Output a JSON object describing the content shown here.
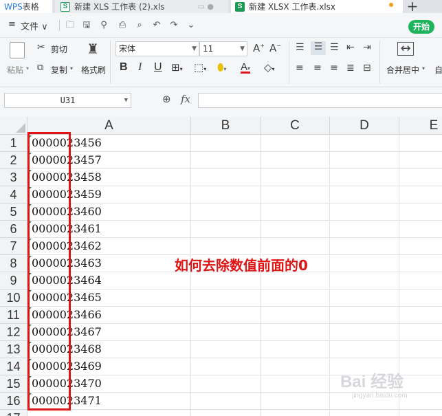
{
  "tabs": {
    "wps_prefix": "WPS",
    "wps_label": " 表格",
    "xls_icon": "S",
    "xls_label": "新建 XLS 工作表 (2).xls",
    "xlsx_icon": "S",
    "xlsx_label": "新建 XLSX 工作表.xlsx",
    "new_tab": "+",
    "unsaved_dot_color": "#f0a020"
  },
  "quickbar": {
    "menu_icon": "≡",
    "file_label": "文件 ∨",
    "icons": [
      "open-folder-icon",
      "save-icon",
      "link-icon",
      "print-icon",
      "print-preview-icon",
      "undo-icon",
      "redo-icon",
      "customize-icon"
    ],
    "start_label": "开始",
    "start_color": "#1eb45e"
  },
  "ribbon": {
    "paste": "粘贴",
    "cut": "剪切",
    "copy": "复制",
    "format_painter": "格式刷",
    "font_name": "宋体",
    "font_size": "11",
    "bold": "B",
    "italic": "I",
    "underline": "U",
    "merge_center": "合并居中",
    "auto_wrap": "自"
  },
  "formula_bar": {
    "cell_ref": "U31",
    "fx": "fx"
  },
  "columns": [
    "A",
    "B",
    "C",
    "D",
    "E"
  ],
  "rows": [
    {
      "num": "1",
      "a": "0000023456"
    },
    {
      "num": "2",
      "a": "0000023457"
    },
    {
      "num": "3",
      "a": "0000023458"
    },
    {
      "num": "4",
      "a": "0000023459"
    },
    {
      "num": "5",
      "a": "0000023460"
    },
    {
      "num": "6",
      "a": "0000023461"
    },
    {
      "num": "7",
      "a": "0000023462"
    },
    {
      "num": "8",
      "a": "0000023463"
    },
    {
      "num": "9",
      "a": "0000023464"
    },
    {
      "num": "10",
      "a": "0000023465"
    },
    {
      "num": "11",
      "a": "0000023466"
    },
    {
      "num": "12",
      "a": "0000023467"
    },
    {
      "num": "13",
      "a": "0000023468"
    },
    {
      "num": "14",
      "a": "0000023469"
    },
    {
      "num": "15",
      "a": "0000023470"
    },
    {
      "num": "16",
      "a": "0000023471"
    },
    {
      "num": "17",
      "a": ""
    }
  ],
  "annotation": {
    "text": "如何去除数值前面的0",
    "color": "#e01414"
  },
  "watermark": {
    "text": "Bai 经验",
    "sub": "jingyan.baidu.com"
  }
}
